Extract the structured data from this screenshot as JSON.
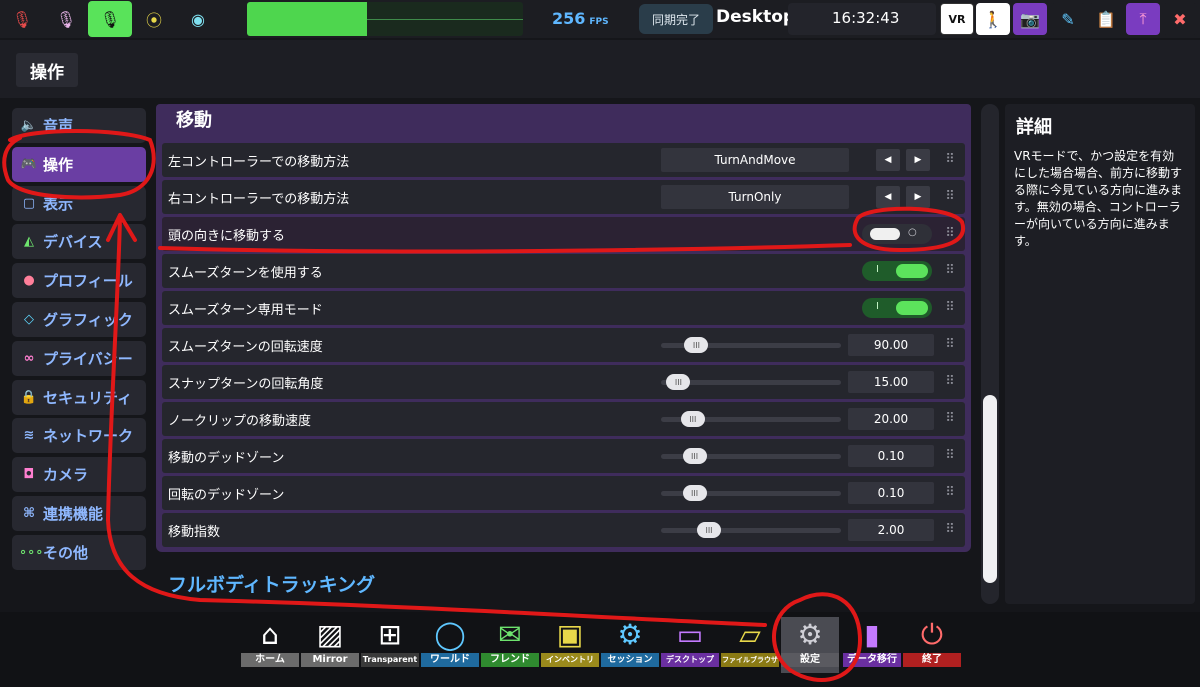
{
  "topbar": {
    "fps_value": "256",
    "fps_unit": "FPS",
    "sync_status": "同期完了",
    "mode": "Desktop",
    "time": "16:32:43",
    "vr_label": "VR"
  },
  "page": {
    "title": "操作"
  },
  "sidebar": {
    "items": [
      {
        "label": "音声",
        "icon": "speaker-icon"
      },
      {
        "label": "操作",
        "icon": "gamepad-icon"
      },
      {
        "label": "表示",
        "icon": "display-icon"
      },
      {
        "label": "デバイス",
        "icon": "device-icon"
      },
      {
        "label": "プロフィール",
        "icon": "person-icon"
      },
      {
        "label": "グラフィック",
        "icon": "diamond-icon"
      },
      {
        "label": "プライバシー",
        "icon": "glasses-icon"
      },
      {
        "label": "セキュリティ",
        "icon": "lock-icon"
      },
      {
        "label": "ネットワーク",
        "icon": "wifi-icon"
      },
      {
        "label": "カメラ",
        "icon": "camera-icon"
      },
      {
        "label": "連携機能",
        "icon": "link-icon"
      },
      {
        "label": "その他",
        "icon": "dots-icon"
      }
    ]
  },
  "section": {
    "title": "移動",
    "next_title": "フルボディトラッキング",
    "rows": [
      {
        "label": "左コントローラーでの移動方法",
        "type": "enum",
        "value": "TurnAndMove"
      },
      {
        "label": "右コントローラーでの移動方法",
        "type": "enum",
        "value": "TurnOnly"
      },
      {
        "label": "頭の向きに移動する",
        "type": "toggle",
        "on": false
      },
      {
        "label": "スムーズターンを使用する",
        "type": "toggle",
        "on": true
      },
      {
        "label": "スムーズターン専用モード",
        "type": "toggle",
        "on": true
      },
      {
        "label": "スムーズターンの回転速度",
        "type": "slider",
        "value": "90.00",
        "fraction": 0.13
      },
      {
        "label": "スナップターンの回転角度",
        "type": "slider",
        "value": "15.00",
        "fraction": 0.03
      },
      {
        "label": "ノークリップの移動速度",
        "type": "slider",
        "value": "20.00",
        "fraction": 0.11
      },
      {
        "label": "移動のデッドゾーン",
        "type": "slider",
        "value": "0.10",
        "fraction": 0.12
      },
      {
        "label": "回転のデッドゾーン",
        "type": "slider",
        "value": "0.10",
        "fraction": 0.12
      },
      {
        "label": "移動指数",
        "type": "slider",
        "value": "2.00",
        "fraction": 0.2
      }
    ]
  },
  "details": {
    "title": "詳細",
    "text": "VRモードで、かつ設定を有効にした場合場合、前方に移動する際に今見ている方向に進みます。無効の場合、コントローラーが向いている方向に進みます。"
  },
  "dock": {
    "items": [
      {
        "label": "ホーム",
        "icon": "home-icon",
        "color": "#6b6b6b"
      },
      {
        "label": "Mirror",
        "icon": "mirror-icon",
        "color": "#6b6b6b"
      },
      {
        "label": "Transparent",
        "icon": "plus-square-icon",
        "color": "#3a3a3a"
      },
      {
        "label": "ワールド",
        "icon": "world-icon",
        "color": "#1f6a9e"
      },
      {
        "label": "フレンド",
        "icon": "mail-icon",
        "color": "#2f8a2f"
      },
      {
        "label": "インベントリ",
        "icon": "backpack-icon",
        "color": "#9a8a1c"
      },
      {
        "label": "セッション",
        "icon": "gear-session-icon",
        "color": "#1f6a9e"
      },
      {
        "label": "デスクトップ",
        "icon": "monitor-icon",
        "color": "#6a2fa0"
      },
      {
        "label": "ファイルブラウザ",
        "icon": "folder-icon",
        "color": "#8a7a14"
      },
      {
        "label": "設定",
        "icon": "settings-icon",
        "color": "#5a5a60"
      },
      {
        "label": "データ移行",
        "icon": "battery-icon",
        "color": "#6a2fa0"
      },
      {
        "label": "終了",
        "icon": "power-icon",
        "color": "#b02020"
      }
    ]
  },
  "colors": {
    "accent_purple": "#6a3ea3",
    "toggle_on": "#5ce35c",
    "link_blue": "#5fb7ff",
    "annotation_red": "#e01818"
  }
}
